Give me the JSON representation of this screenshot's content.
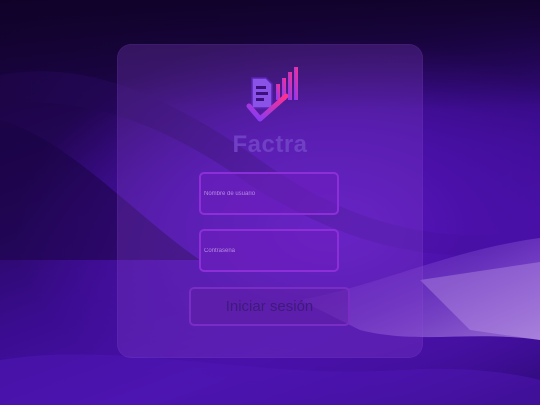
{
  "brand": {
    "name": "Factra",
    "logo_icon": "invoice-chart-check-icon"
  },
  "form": {
    "username_placeholder": "Nombre de usuario",
    "password_placeholder": "Contraseña",
    "username_value": "",
    "password_value": "",
    "submit_label": "Iniciar sesión"
  },
  "colors": {
    "accent": "#8d2fd8",
    "logo_gradient_start": "#7b3cff",
    "logo_gradient_end": "#ff2f8e",
    "brand_text": "#6f3fc4"
  }
}
